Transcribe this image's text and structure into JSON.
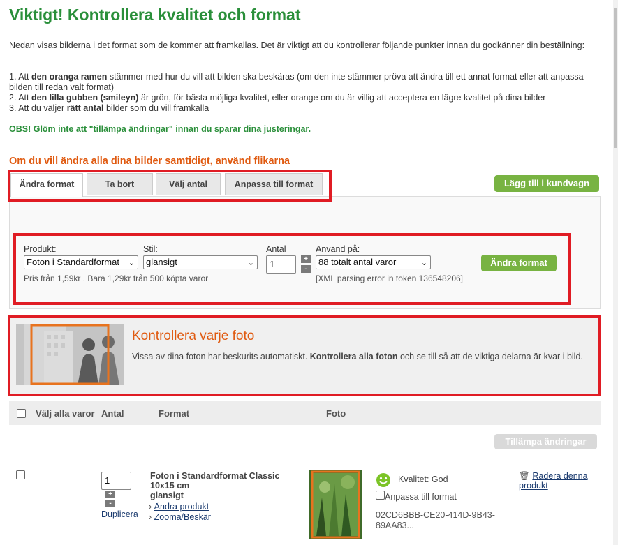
{
  "header": {
    "title": "Viktigt! Kontrollera kvalitet och format",
    "intro": "Nedan visas bilderna i det format som de kommer att framkallas. Det är viktigt att du kontrollerar följande punkter innan du godkänner din beställning:",
    "point1_a": "1. Att ",
    "point1_b": "den oranga ramen",
    "point1_c": " stämmer med hur du vill att bilden ska beskäras (om den inte stämmer pröva att ändra till ett annat format eller att anpassa bilden till redan valt format)",
    "point2_a": "2. Att ",
    "point2_b": "den lilla gubben (smileyn)",
    "point2_c": " är grön, för bästa möjliga kvalitet, eller orange om du är villig att acceptera en lägre kvalitet på dina bilder",
    "point3_a": "3. Att du väljer ",
    "point3_b": "rätt antal",
    "point3_c": " bilder som du vill framkalla",
    "obs": "OBS! Glöm inte att \"tillämpa ändringar\" innan du sparar dina justeringar.",
    "tabs_heading": "Om du vill ändra alla dina bilder samtidigt, använd flikarna"
  },
  "tabs": [
    {
      "label": "Ändra format"
    },
    {
      "label": "Ta bort"
    },
    {
      "label": "Välj antal"
    },
    {
      "label": "Anpassa till format"
    }
  ],
  "add_to_cart": "Lägg till i kundvagn",
  "form": {
    "produkt_label": "Produkt:",
    "produkt_value": "Foton i Standardformat",
    "stil_label": "Stil:",
    "stil_value": "glansigt",
    "antal_label": "Antal",
    "antal_value": "1",
    "anvand_label": "Använd på:",
    "anvand_value": "88 totalt antal varor",
    "price_note": "Pris från 1,59kr . Bara 1,29kr från 500 köpta varor",
    "error_note": "[XML parsing error in token 136548206]",
    "apply_button": "Ändra format",
    "plus": "+",
    "minus": "-"
  },
  "info": {
    "title": "Kontrollera varje foto",
    "text_a": "Vissa av dina foton har beskurits automatiskt. ",
    "text_b": "Kontrollera alla foton",
    "text_c": " och se till så att de viktiga delarna är kvar i bild."
  },
  "table": {
    "col_select_all": "Välj alla varor",
    "col_antal": "Antal",
    "col_format": "Format",
    "col_foto": "Foto",
    "apply_changes": "Tillämpa ändringar"
  },
  "row": {
    "quantity": "1",
    "plus": "+",
    "minus": "-",
    "duplicate": "Duplicera",
    "product_line1": "Foton i Standardformat Classic",
    "product_line2": "10x15 cm",
    "product_line3": "glansigt",
    "change_product": "Ändra produkt",
    "zoom_crop": "Zooma/Beskär",
    "quality": "Kvalitet: God",
    "fit_format": "Anpassa till format",
    "photo_id_1": "02CD6BBB-CE20-414D-9B43-",
    "photo_id_2": "89AA83...",
    "delete": "Radera denna produkt"
  },
  "colors": {
    "green_title": "#2a8f3a",
    "orange": "#e05a10",
    "highlight_red": "#e01c24",
    "button_green": "#78b342"
  }
}
